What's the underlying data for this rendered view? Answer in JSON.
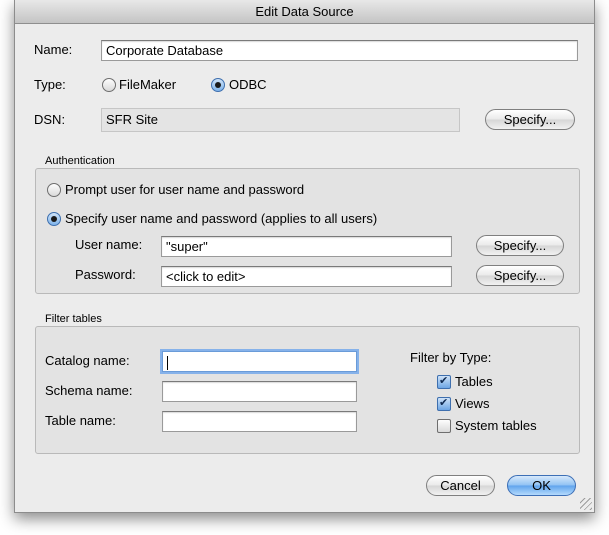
{
  "window": {
    "title": "Edit Data Source"
  },
  "form": {
    "name_label": "Name:",
    "name_value": "Corporate Database",
    "type_label": "Type:",
    "type_options": [
      "FileMaker",
      "ODBC"
    ],
    "type_selected": "ODBC",
    "dsn_label": "DSN:",
    "dsn_value": "SFR Site",
    "dsn_specify": "Specify..."
  },
  "authentication": {
    "title": "Authentication",
    "prompt_option": "Prompt user for user name and password",
    "specify_option": "Specify user name and password (applies to all users)",
    "selected": "specify",
    "username_label": "User name:",
    "username_value": "\"super\"",
    "username_specify": "Specify...",
    "password_label": "Password:",
    "password_value": "<click to edit>",
    "password_specify": "Specify..."
  },
  "filter": {
    "title": "Filter tables",
    "catalog_label": "Catalog name:",
    "catalog_value": "",
    "schema_label": "Schema name:",
    "schema_value": "",
    "table_label": "Table name:",
    "table_value": "",
    "type_heading": "Filter by Type:",
    "types": [
      {
        "label": "Tables",
        "checked": true
      },
      {
        "label": "Views",
        "checked": true
      },
      {
        "label": "System tables",
        "checked": false
      }
    ]
  },
  "buttons": {
    "cancel": "Cancel",
    "ok": "OK"
  }
}
